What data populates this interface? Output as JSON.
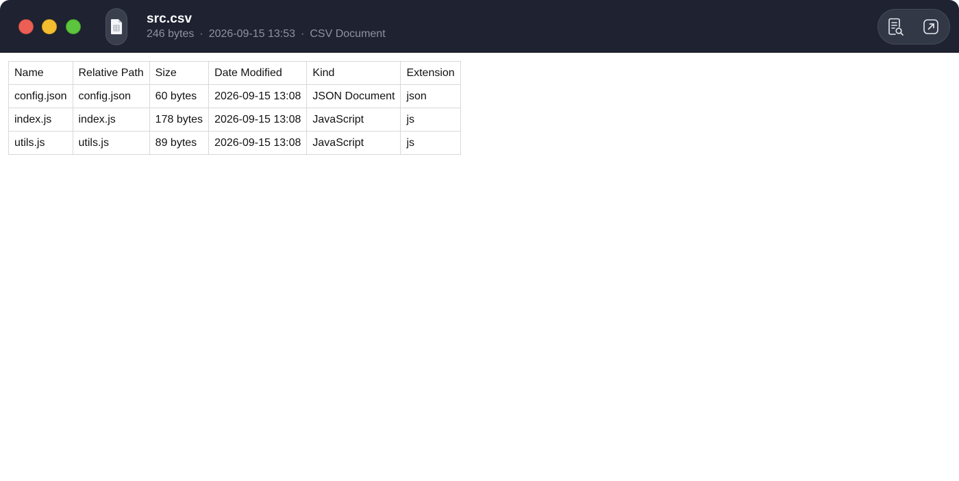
{
  "window": {
    "title": "src.csv",
    "meta": {
      "size": "246 bytes",
      "separator": "·",
      "modified": "2026-09-15 13:53",
      "kind": "CSV Document"
    }
  },
  "icons": {
    "file": "spreadsheet-file-icon",
    "quicklook": "document-search-icon",
    "open": "open-external-icon"
  },
  "colors": {
    "titlebar": "#1e2231",
    "close": "#ec5f55",
    "minimize": "#f3bd2f",
    "zoom": "#5cc43d",
    "meta_text": "#8d93a3"
  },
  "table": {
    "headers": [
      "Name",
      "Relative Path",
      "Size",
      "Date Modified",
      "Kind",
      "Extension"
    ],
    "rows": [
      [
        "config.json",
        "config.json",
        "60 bytes",
        "2026-09-15 13:08",
        "JSON Document",
        "json"
      ],
      [
        "index.js",
        "index.js",
        "178 bytes",
        "2026-09-15 13:08",
        "JavaScript",
        "js"
      ],
      [
        "utils.js",
        "utils.js",
        "89 bytes",
        "2026-09-15 13:08",
        "JavaScript",
        "js"
      ]
    ]
  }
}
